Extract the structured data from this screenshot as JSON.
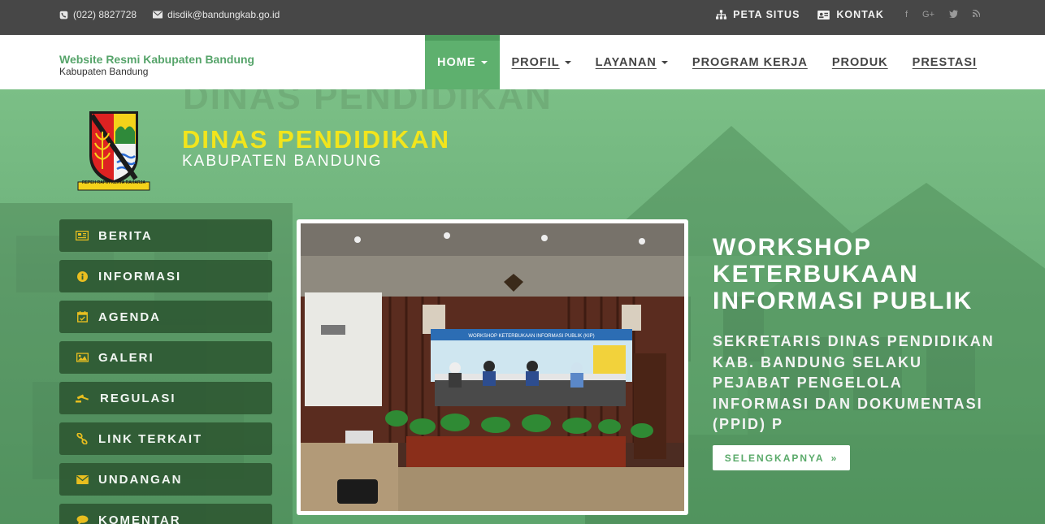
{
  "topbar": {
    "phone": "(022) 8827728",
    "email": "disdik@bandungkab.go.id",
    "links": [
      {
        "label": "PETA SITUS",
        "icon": "sitemap-icon"
      },
      {
        "label": "KONTAK",
        "icon": "id-card-icon"
      }
    ],
    "social": [
      "facebook-icon",
      "google-plus-icon",
      "twitter-icon",
      "rss-icon"
    ]
  },
  "header": {
    "site_title": "Website Resmi Kabupaten Bandung",
    "site_subtitle": "Kabupaten Bandung",
    "nav": [
      {
        "label": "HOME",
        "dropdown": true,
        "active": true
      },
      {
        "label": "PROFIL",
        "dropdown": true
      },
      {
        "label": "LAYANAN",
        "dropdown": true
      },
      {
        "label": "PROGRAM KERJA",
        "dropdown": false
      },
      {
        "label": "PRODUK",
        "dropdown": false
      },
      {
        "label": "PRESTASI",
        "dropdown": false
      }
    ],
    "accent_color": "#5eb06e"
  },
  "brand": {
    "title": "DINAS PENDIDIKAN",
    "subtitle": "KABUPATEN BANDUNG",
    "logo_motto": "REPEH RAPIH KERTA RAHARJA",
    "title_color": "#f2e51c"
  },
  "side_menu": [
    {
      "label": "BERITA",
      "icon": "newspaper-icon"
    },
    {
      "label": "INFORMASI",
      "icon": "info-icon"
    },
    {
      "label": "AGENDA",
      "icon": "calendar-icon"
    },
    {
      "label": "GALERI",
      "icon": "image-icon"
    },
    {
      "label": "REGULASI",
      "icon": "gavel-icon"
    },
    {
      "label": "LINK TERKAIT",
      "icon": "link-icon"
    },
    {
      "label": "UNDANGAN",
      "icon": "envelope-icon"
    },
    {
      "label": "KOMENTAR",
      "icon": "comment-icon"
    }
  ],
  "slide": {
    "title": "WORKSHOP KETERBUKAAN INFORMASI PUBLIK",
    "text": "SEKRETARIS DINAS PENDIDIKAN KAB. BANDUNG SELAKU PEJABAT PENGELOLA INFORMASI DAN DOKUMENTASI (PPID) P",
    "button": "SELENGKAPNYA",
    "banner_text": "WORKSHOP KETERBUKAAN INFORMASI PUBLIK (KIP)"
  }
}
